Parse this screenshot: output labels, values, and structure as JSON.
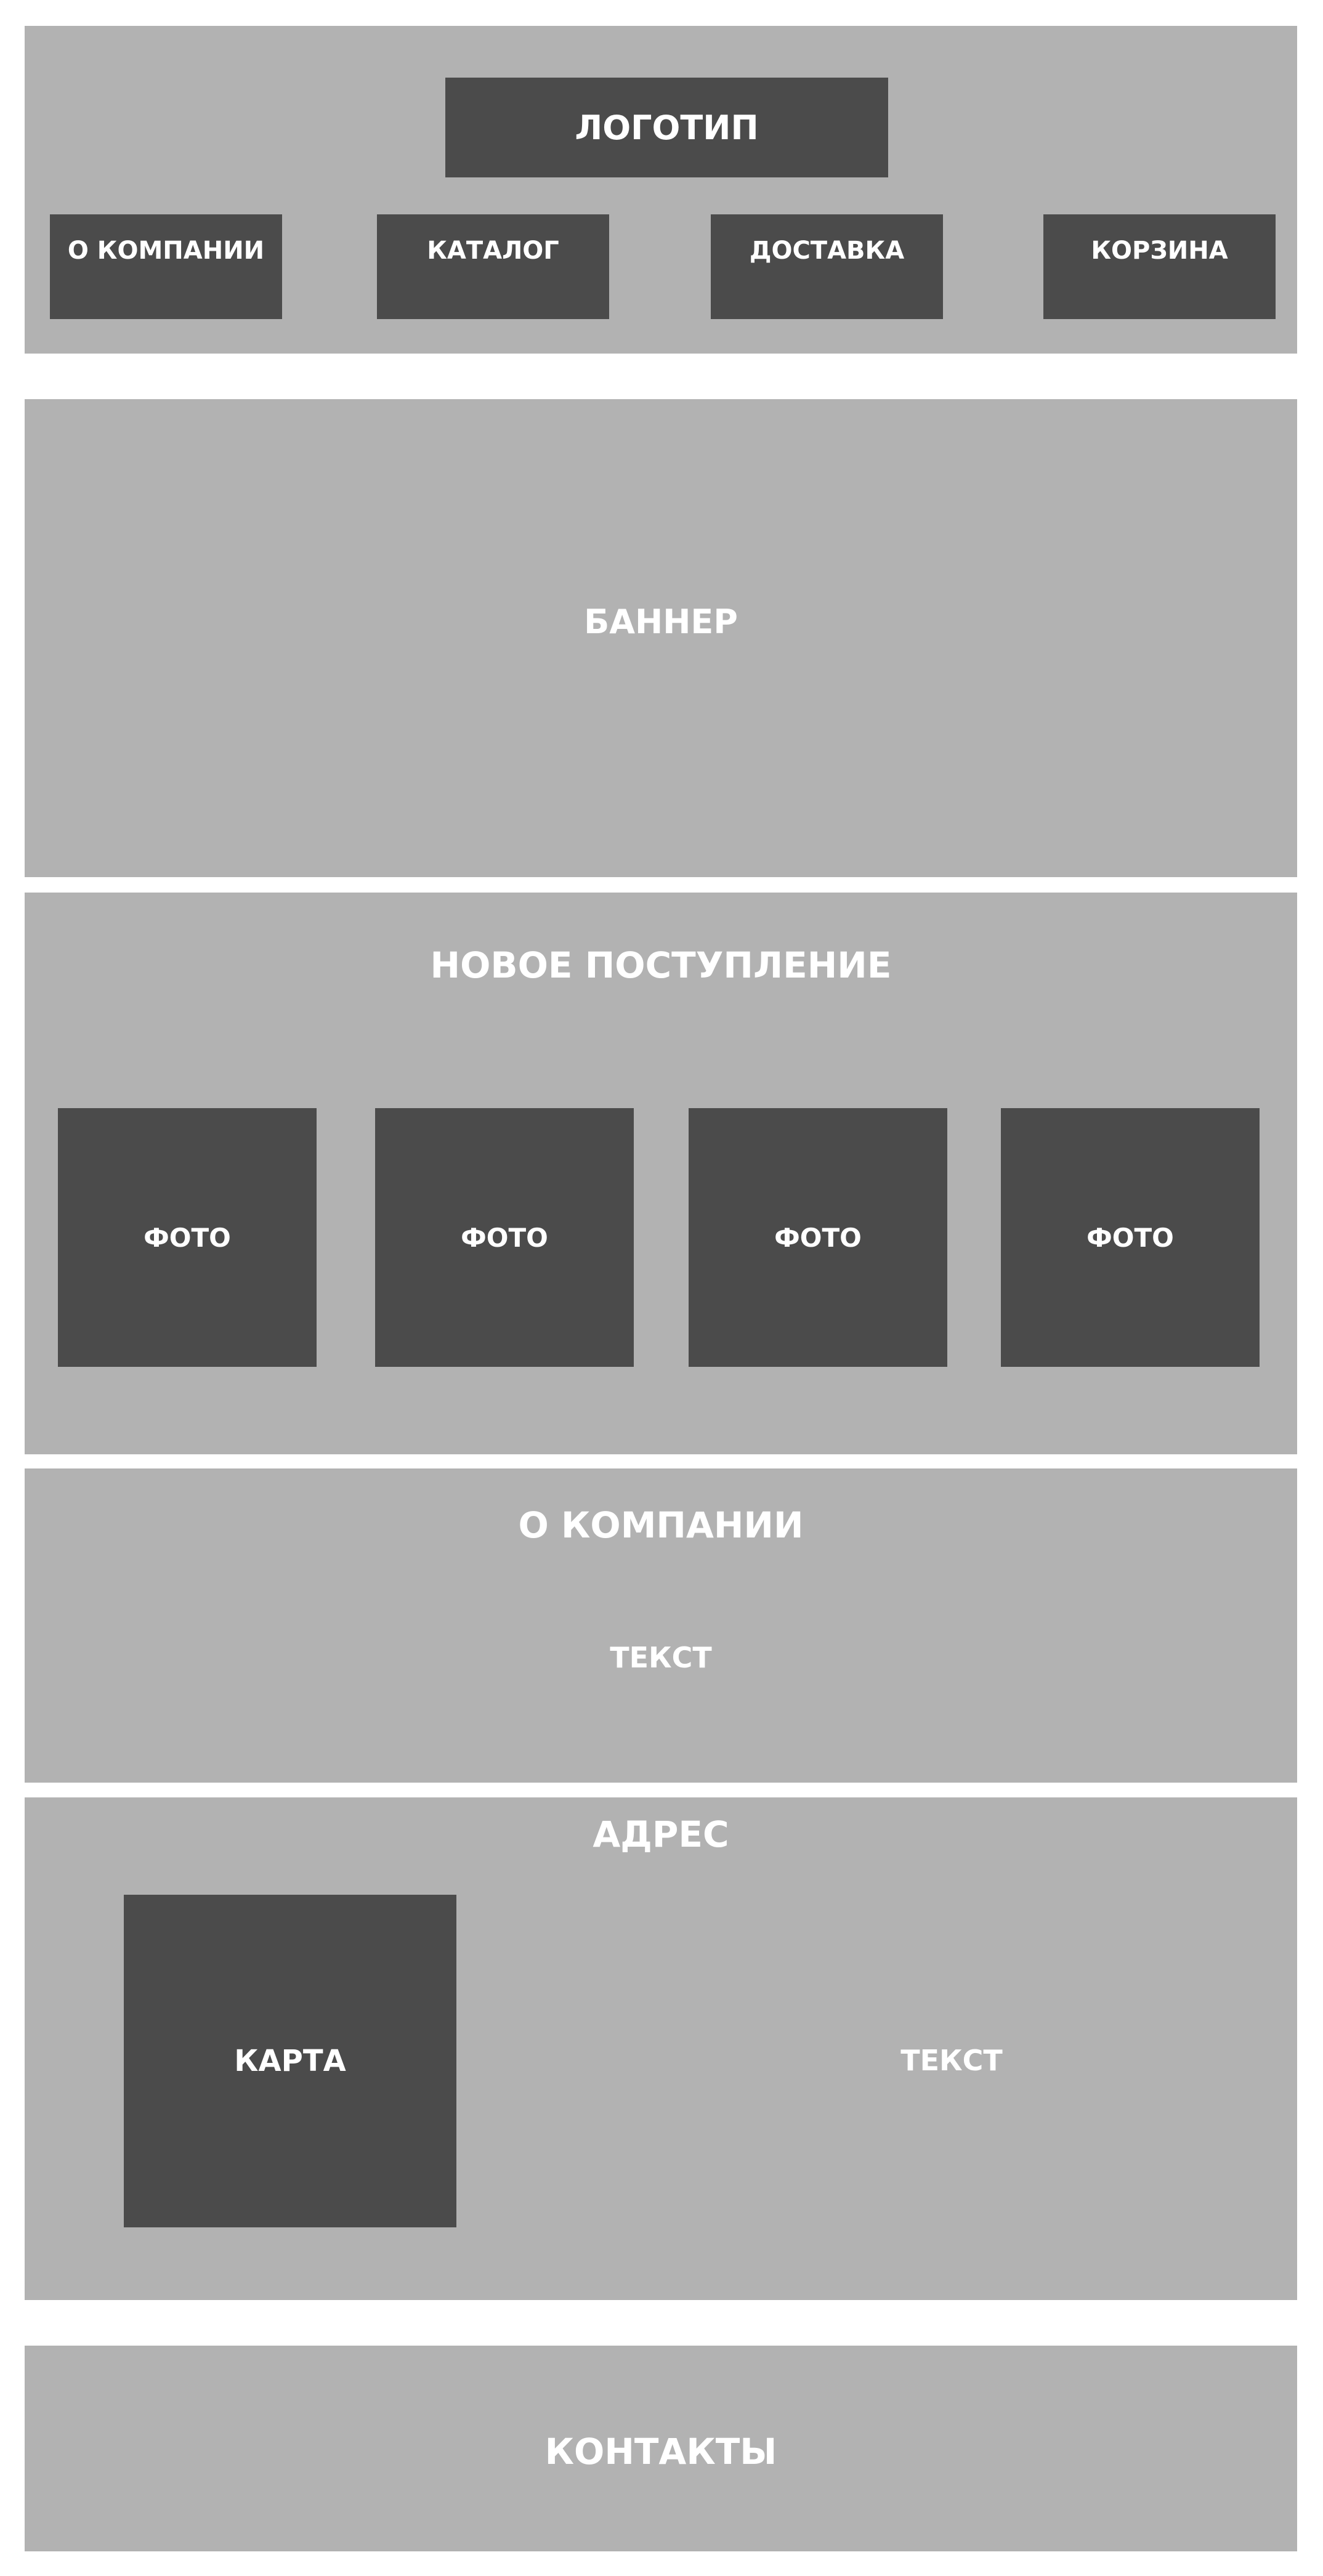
{
  "header": {
    "logo": "ЛОГОТИП",
    "nav": [
      {
        "label": "О КОМПАНИИ"
      },
      {
        "label": "КАТАЛОГ"
      },
      {
        "label": "ДОСТАВКА"
      },
      {
        "label": "КОРЗИНА"
      }
    ]
  },
  "banner": {
    "label": "БАННЕР"
  },
  "new_arrivals": {
    "title": "НОВОЕ ПОСТУПЛЕНИЕ",
    "photos": [
      {
        "label": "ФОТО"
      },
      {
        "label": "ФОТО"
      },
      {
        "label": "ФОТО"
      },
      {
        "label": "ФОТО"
      }
    ]
  },
  "about": {
    "title": "О КОМПАНИИ",
    "text": "ТЕКСТ"
  },
  "address": {
    "title": "АДРЕС",
    "map_label": "КАРТА",
    "text": "ТЕКСТ"
  },
  "contacts": {
    "label": "КОНТАКТЫ"
  },
  "colors": {
    "panel": "#b2b2b2",
    "block": "#4b4b4b",
    "text": "#ffffff",
    "background": "#ffffff"
  }
}
